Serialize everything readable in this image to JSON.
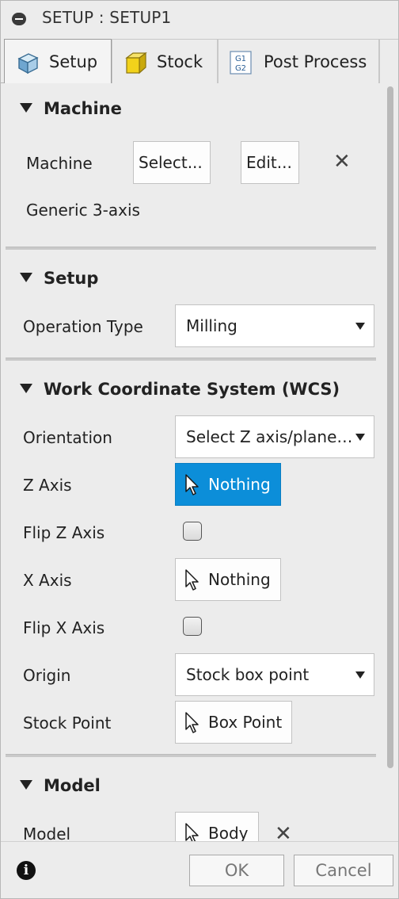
{
  "window": {
    "title": "SETUP : SETUP1",
    "title_icon": "minus-circle-icon"
  },
  "tabs": [
    {
      "label": "Setup",
      "icon": "setup-cube-icon",
      "active": true
    },
    {
      "label": "Stock",
      "icon": "stock-box-icon",
      "active": false
    },
    {
      "label": "Post Process",
      "icon": "g-code-icon",
      "icon_text_top": "G1",
      "icon_text_bottom": "G2",
      "active": false
    }
  ],
  "sections": {
    "machine": {
      "header": "Machine",
      "label": "Machine",
      "select_button": "Select...",
      "edit_button": "Edit...",
      "clear_symbol": "✕",
      "machine_name": "Generic 3-axis"
    },
    "setup": {
      "header": "Setup",
      "operation_type_label": "Operation Type",
      "operation_type_value": "Milling"
    },
    "wcs": {
      "header": "Work Coordinate System (WCS)",
      "orientation_label": "Orientation",
      "orientation_value": "Select Z axis/plane & X axis",
      "z_axis_label": "Z Axis",
      "z_axis_value": "Nothing",
      "flip_z_label": "Flip Z Axis",
      "flip_z_checked": false,
      "x_axis_label": "X Axis",
      "x_axis_value": "Nothing",
      "flip_x_label": "Flip X Axis",
      "flip_x_checked": false,
      "origin_label": "Origin",
      "origin_value": "Stock box point",
      "stock_point_label": "Stock Point",
      "stock_point_value": "Box Point"
    },
    "model": {
      "header": "Model",
      "model_label": "Model",
      "model_value": "Body",
      "clear_symbol": "✕"
    }
  },
  "footer": {
    "info_symbol": "i",
    "ok_label": "OK",
    "cancel_label": "Cancel"
  },
  "colors": {
    "accent": "#0c8ed9",
    "panel_bg": "#ececec",
    "stock_icon": "#f2d21b"
  }
}
